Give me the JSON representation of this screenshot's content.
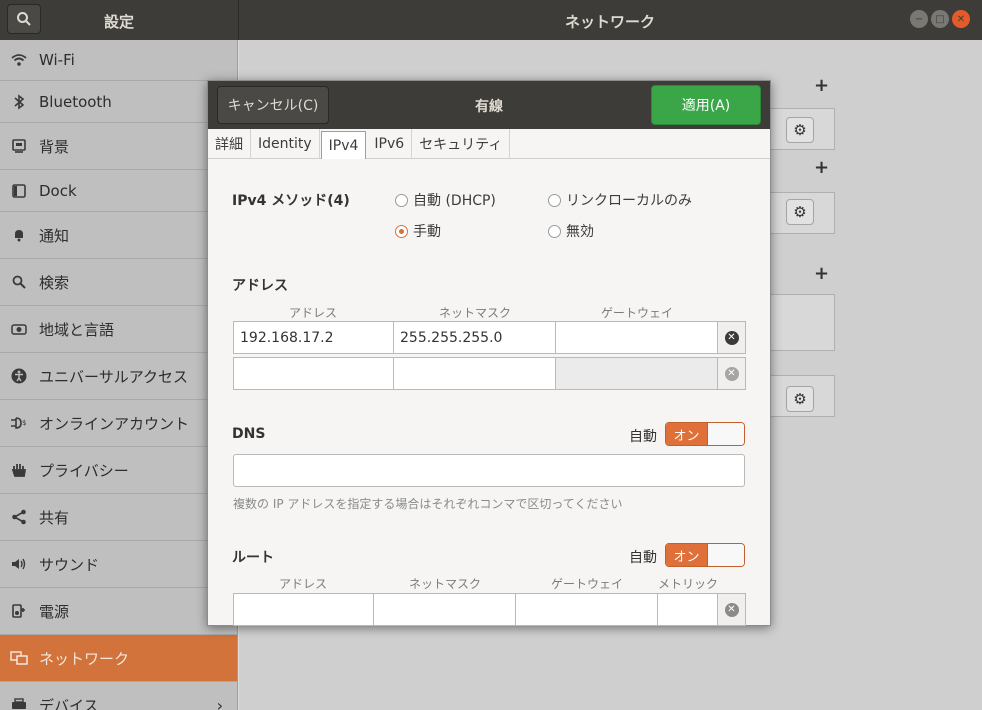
{
  "window": {
    "sidebar_title": "設定",
    "title": "ネットワーク"
  },
  "sidebar": {
    "items": [
      {
        "label": "Wi-Fi",
        "icon": "wifi-icon"
      },
      {
        "label": "Bluetooth",
        "icon": "bluetooth-icon"
      },
      {
        "label": "背景",
        "icon": "background-icon"
      },
      {
        "label": "Dock",
        "icon": "dock-icon"
      },
      {
        "label": "通知",
        "icon": "bell-icon"
      },
      {
        "label": "検索",
        "icon": "search-icon"
      },
      {
        "label": "地域と言語",
        "icon": "camera-icon"
      },
      {
        "label": "ユニバーサルアクセス",
        "icon": "accessibility-icon"
      },
      {
        "label": "オンラインアカウント",
        "icon": "online-accounts-icon"
      },
      {
        "label": "プライバシー",
        "icon": "hand-icon"
      },
      {
        "label": "共有",
        "icon": "share-icon"
      },
      {
        "label": "サウンド",
        "icon": "speaker-icon"
      },
      {
        "label": "電源",
        "icon": "power-icon"
      },
      {
        "label": "ネットワーク",
        "icon": "network-icon",
        "active": true
      },
      {
        "label": "デバイス",
        "icon": "printer-icon",
        "chevron": true
      }
    ]
  },
  "dialog": {
    "cancel_label": "キャンセル(C)",
    "title": "有線",
    "apply_label": "適用(A)",
    "tabs": [
      "詳細",
      "Identity",
      "IPv4",
      "IPv6",
      "セキュリティ"
    ],
    "active_tab": "IPv4",
    "method": {
      "label": "IPv4 メソッド(4)",
      "options": {
        "dhcp": "自動 (DHCP)",
        "link_local": "リンクローカルのみ",
        "manual": "手動",
        "disabled": "無効"
      },
      "selected": "manual"
    },
    "addresses": {
      "label": "アドレス",
      "col_address": "アドレス",
      "col_netmask": "ネットマスク",
      "col_gateway": "ゲートウェイ",
      "rows": [
        {
          "address": "192.168.17.2",
          "netmask": "255.255.255.0",
          "gateway": ""
        },
        {
          "address": "",
          "netmask": "",
          "gateway": ""
        }
      ]
    },
    "dns": {
      "label": "DNS",
      "auto_label": "自動",
      "toggle_label": "オン",
      "value": "",
      "hint": "複数の IP アドレスを指定する場合はそれぞれコンマで区切ってください"
    },
    "routes": {
      "label": "ルート",
      "auto_label": "自動",
      "toggle_label": "オン",
      "col_address": "アドレス",
      "col_netmask": "ネットマスク",
      "col_gateway": "ゲートウェイ",
      "col_metric": "メトリック"
    }
  },
  "colors": {
    "accent": "#d2733b",
    "apply_green": "#3aa647",
    "titlebar": "#3d3c38"
  }
}
